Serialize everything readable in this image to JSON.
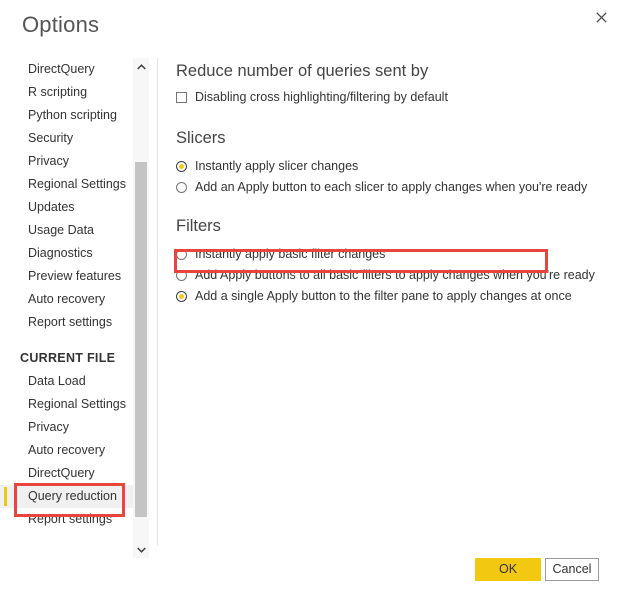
{
  "dialog": {
    "title": "Options",
    "close_icon": "close-icon"
  },
  "sidebar": {
    "global_items": [
      {
        "label": "DirectQuery"
      },
      {
        "label": "R scripting"
      },
      {
        "label": "Python scripting"
      },
      {
        "label": "Security"
      },
      {
        "label": "Privacy"
      },
      {
        "label": "Regional Settings"
      },
      {
        "label": "Updates"
      },
      {
        "label": "Usage Data"
      },
      {
        "label": "Diagnostics"
      },
      {
        "label": "Preview features"
      },
      {
        "label": "Auto recovery"
      },
      {
        "label": "Report settings"
      }
    ],
    "group_header": "CURRENT FILE",
    "current_file_items": [
      {
        "label": "Data Load",
        "selected": false
      },
      {
        "label": "Regional Settings",
        "selected": false
      },
      {
        "label": "Privacy",
        "selected": false
      },
      {
        "label": "Auto recovery",
        "selected": false
      },
      {
        "label": "DirectQuery",
        "selected": false
      },
      {
        "label": "Query reduction",
        "selected": true
      },
      {
        "label": "Report settings",
        "selected": false
      }
    ],
    "scrollbar": {
      "up_arrow_icon": "chevron-up-icon",
      "down_arrow_icon": "chevron-down-icon"
    }
  },
  "main": {
    "reduce_heading": "Reduce number of queries sent by",
    "cross_highlight_checkbox": {
      "label": "Disabling cross highlighting/filtering by default",
      "checked": false
    },
    "slicers": {
      "heading": "Slicers",
      "options": [
        {
          "label": "Instantly apply slicer changes",
          "checked": true
        },
        {
          "label": "Add an Apply button to each slicer to apply changes when you're ready",
          "checked": false
        }
      ]
    },
    "filters": {
      "heading": "Filters",
      "options": [
        {
          "label": "Instantly apply basic filter changes",
          "checked": false
        },
        {
          "label": "Add Apply buttons to all basic filters to apply changes when you're ready",
          "checked": false
        },
        {
          "label": "Add a single Apply button to the filter pane to apply changes at once",
          "checked": true
        }
      ]
    }
  },
  "footer": {
    "ok_label": "OK",
    "cancel_label": "Cancel"
  },
  "colors": {
    "accent_yellow": "#f2c811",
    "annotation_red": "#e8453c",
    "selected_row_bg": "#f0f0f0"
  }
}
